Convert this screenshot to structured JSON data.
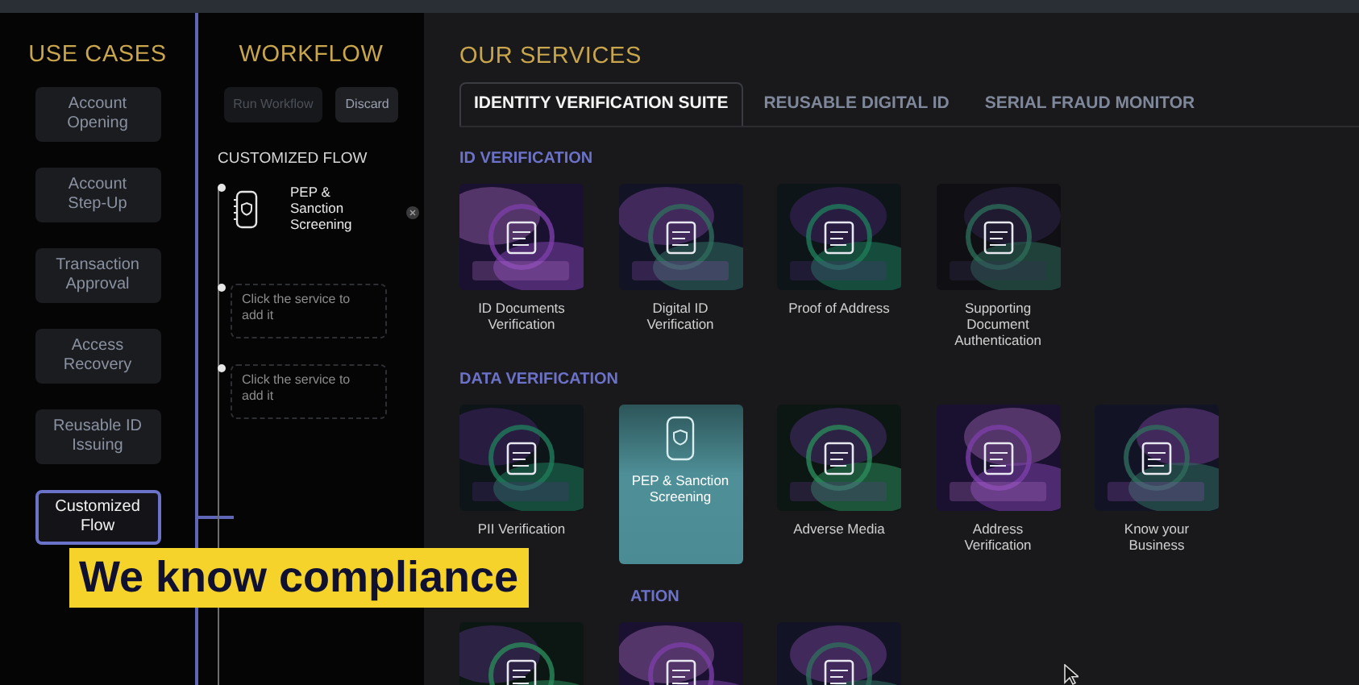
{
  "use_cases": {
    "title": "USE CASES",
    "items": [
      {
        "label": "Account Opening",
        "selected": false
      },
      {
        "label": "Account Step-Up",
        "selected": false
      },
      {
        "label": "Transaction Approval",
        "selected": false
      },
      {
        "label": "Access Recovery",
        "selected": false
      },
      {
        "label": "Reusable ID Issuing",
        "selected": false
      },
      {
        "label": "Customized Flow",
        "selected": true
      }
    ]
  },
  "workflow": {
    "title": "WORKFLOW",
    "buttons": [
      {
        "label": "Run Workflow",
        "disabled": true
      },
      {
        "label": "Discard",
        "disabled": false
      }
    ],
    "flow_title": "CUSTOMIZED FLOW",
    "steps": [
      {
        "kind": "service",
        "label": "PEP & Sanction Screening"
      },
      {
        "kind": "placeholder",
        "text": "Click the service to add it"
      },
      {
        "kind": "placeholder",
        "text": "Click the service to add it"
      }
    ]
  },
  "services": {
    "title": "OUR SERVICES",
    "tabs": [
      {
        "label": "IDENTITY VERIFICATION SUITE",
        "selected": true
      },
      {
        "label": "REUSABLE DIGITAL ID",
        "selected": false
      },
      {
        "label": "SERIAL FRAUD MONITOR",
        "selected": false
      }
    ],
    "sections": [
      {
        "title": "ID VERIFICATION",
        "covered": false,
        "items": [
          {
            "label": "ID Documents Verification",
            "selected": false
          },
          {
            "label": "Digital ID Verification",
            "selected": false
          },
          {
            "label": "Proof of Address",
            "selected": false
          },
          {
            "label": "Supporting Document Authentication",
            "selected": false
          }
        ]
      },
      {
        "title": "DATA VERIFICATION",
        "covered": false,
        "items": [
          {
            "label": "PII Verification",
            "selected": false
          },
          {
            "label": "PEP & Sanction Screening",
            "selected": true
          },
          {
            "label": "Adverse Media",
            "selected": false
          },
          {
            "label": "Address Verification",
            "selected": false
          },
          {
            "label": "Know your Business",
            "selected": false
          }
        ]
      },
      {
        "title": "ATION",
        "covered": true,
        "items": [
          {
            "selected": false
          },
          {
            "selected": false
          },
          {
            "selected": false
          }
        ]
      }
    ]
  },
  "caption": "We know compliance"
}
